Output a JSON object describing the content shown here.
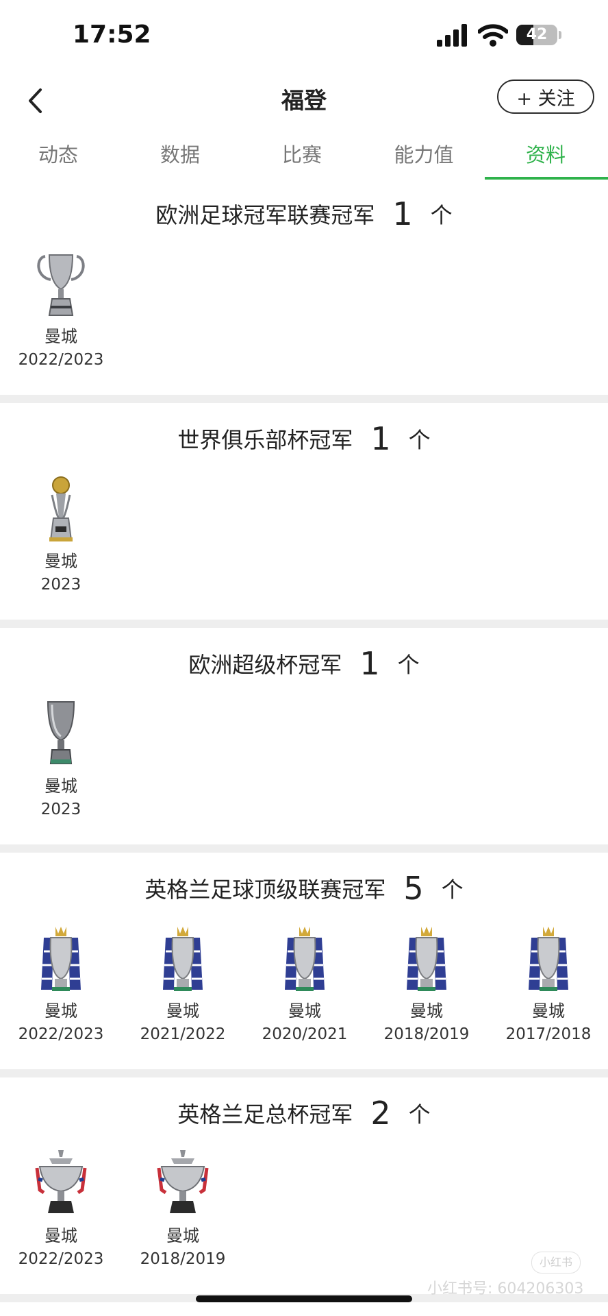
{
  "status_bar": {
    "time": "17:52",
    "battery": "42",
    "battery_level": 0.42
  },
  "nav": {
    "title": "福登",
    "follow_label": "+ 关注"
  },
  "tabs": [
    {
      "label": "动态"
    },
    {
      "label": "数据"
    },
    {
      "label": "比赛"
    },
    {
      "label": "能力值"
    },
    {
      "label": "资料"
    }
  ],
  "active_tab": "资料",
  "accent_color": "#2fb24b",
  "sections": [
    {
      "title": "欧洲足球冠军联赛冠军",
      "count": "1",
      "unit": "个",
      "trophy_icon": "champions-league-trophy-icon",
      "items": [
        {
          "club": "曼城",
          "season": "2022/2023"
        }
      ]
    },
    {
      "title": "世界俱乐部杯冠军",
      "count": "1",
      "unit": "个",
      "trophy_icon": "club-world-cup-trophy-icon",
      "items": [
        {
          "club": "曼城",
          "season": "2023"
        }
      ]
    },
    {
      "title": "欧洲超级杯冠军",
      "count": "1",
      "unit": "个",
      "trophy_icon": "super-cup-trophy-icon",
      "items": [
        {
          "club": "曼城",
          "season": "2023"
        }
      ]
    },
    {
      "title": "英格兰足球顶级联赛冠军",
      "count": "5",
      "unit": "个",
      "trophy_icon": "premier-league-trophy-icon",
      "items": [
        {
          "club": "曼城",
          "season": "2022/2023"
        },
        {
          "club": "曼城",
          "season": "2021/2022"
        },
        {
          "club": "曼城",
          "season": "2020/2021"
        },
        {
          "club": "曼城",
          "season": "2018/2019"
        },
        {
          "club": "曼城",
          "season": "2017/2018"
        }
      ]
    },
    {
      "title": "英格兰足总杯冠军",
      "count": "2",
      "unit": "个",
      "trophy_icon": "fa-cup-trophy-icon",
      "items": [
        {
          "club": "曼城",
          "season": "2022/2023"
        },
        {
          "club": "曼城",
          "season": "2018/2019"
        }
      ]
    }
  ],
  "watermark": {
    "text": "小红书号: 604206303",
    "badge": "小红书"
  }
}
